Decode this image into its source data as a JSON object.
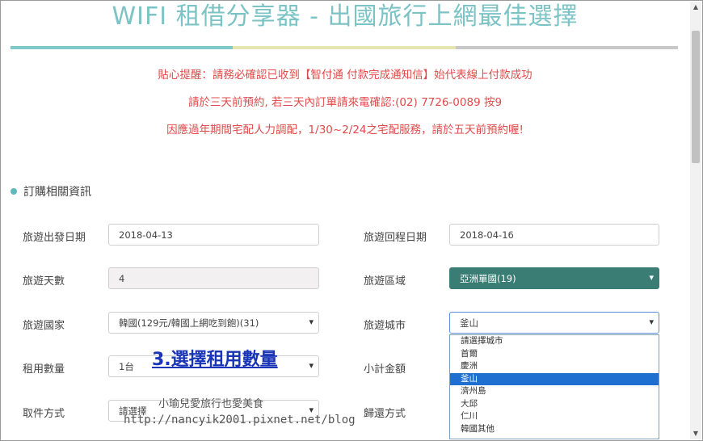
{
  "page": {
    "title": "WIFI 租借分享器 - 出國旅行上網最佳選擇",
    "divider_colors": [
      "#7fc8cb",
      "#e5e5b0",
      "#c8c8c8"
    ],
    "notices": [
      "貼心提醒：請務必確認已收到【智付通 付款完成通知信】始代表線上付款成功",
      "請於三天前預約, 若三天內訂單請來電確認:(02) 7726-0089 按9",
      "因應過年期間宅配人力調配，1/30~2/24之宅配服務，請於五天前預約喔!"
    ]
  },
  "form": {
    "section_title": "訂購相關資訊",
    "depart_label": "旅遊出發日期",
    "depart_value": "2018-04-13",
    "return_label": "旅遊回程日期",
    "return_value": "2018-04-16",
    "days_label": "旅遊天數",
    "days_value": "4",
    "region_label": "旅遊區域",
    "region_value": "亞洲單國(19)",
    "country_label": "旅遊國家",
    "country_value": "韓國(129元/韓國上網吃到飽)(31)",
    "city_label": "旅遊城市",
    "city_value": "釜山",
    "qty_label": "租用數量",
    "qty_value": "1台",
    "subtotal_label": "小計金額",
    "pickup_label": "取件方式",
    "pickup_value": "請選擇",
    "return_method_label": "歸還方式"
  },
  "city_options": [
    "請選擇城市",
    "首爾",
    "慶洲",
    "釜山",
    "濟州島",
    "大邱",
    "仁川",
    "韓國其他"
  ],
  "selected_city_index": 3,
  "overlay": {
    "annotation": "3.選擇租用數量",
    "watermark_line1": "小瑜兒愛旅行也愛美食",
    "watermark_line2": "http://nancyik2001.pixnet.net/blog"
  },
  "colors": {
    "title": "#7cc3c6",
    "notice": "#e14a4a",
    "region_bg": "#3a7d74",
    "highlight": "#1e6fd0",
    "annotation": "#1a34b8"
  }
}
